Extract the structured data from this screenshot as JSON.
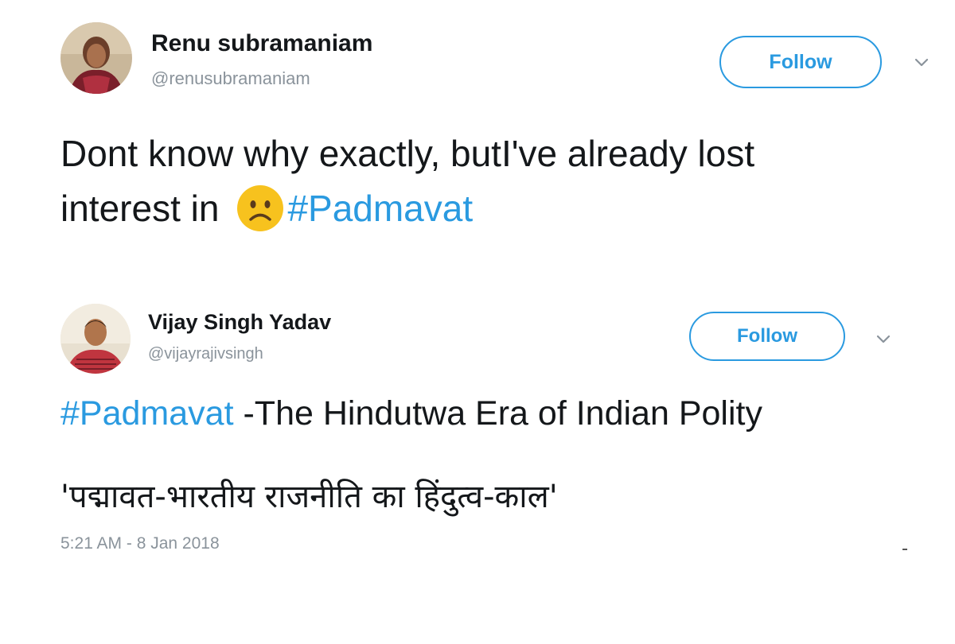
{
  "tweets": [
    {
      "display_name": "Renu subramaniam",
      "handle": "@renusubramaniam",
      "follow_label": "Follow",
      "text_line1": "Dont know why exactly, butI've already lost",
      "text_line2_prefix": "interest in",
      "emoji": "frowning-face",
      "hashtag": "#Padmavat"
    },
    {
      "display_name": "Vijay Singh Yadav",
      "handle": "@vijayrajivsingh",
      "follow_label": "Follow",
      "hashtag": "#Padmavat",
      "text_line1_suffix": " -The Hindutwa Era of Indian Polity",
      "text_line2": "'पद्मावत-भारतीय राजनीति का हिंदुत्व-काल'",
      "timestamp": "5:21 AM - 8 Jan 2018"
    }
  ],
  "colors": {
    "link_blue": "#2a9ae0",
    "handle_gray": "#8a939b",
    "text": "#14171a",
    "emoji_yellow": "#f7c21e"
  },
  "icons": {
    "chevron": "chevron-down-icon",
    "emoji": "frowning-face-icon"
  }
}
